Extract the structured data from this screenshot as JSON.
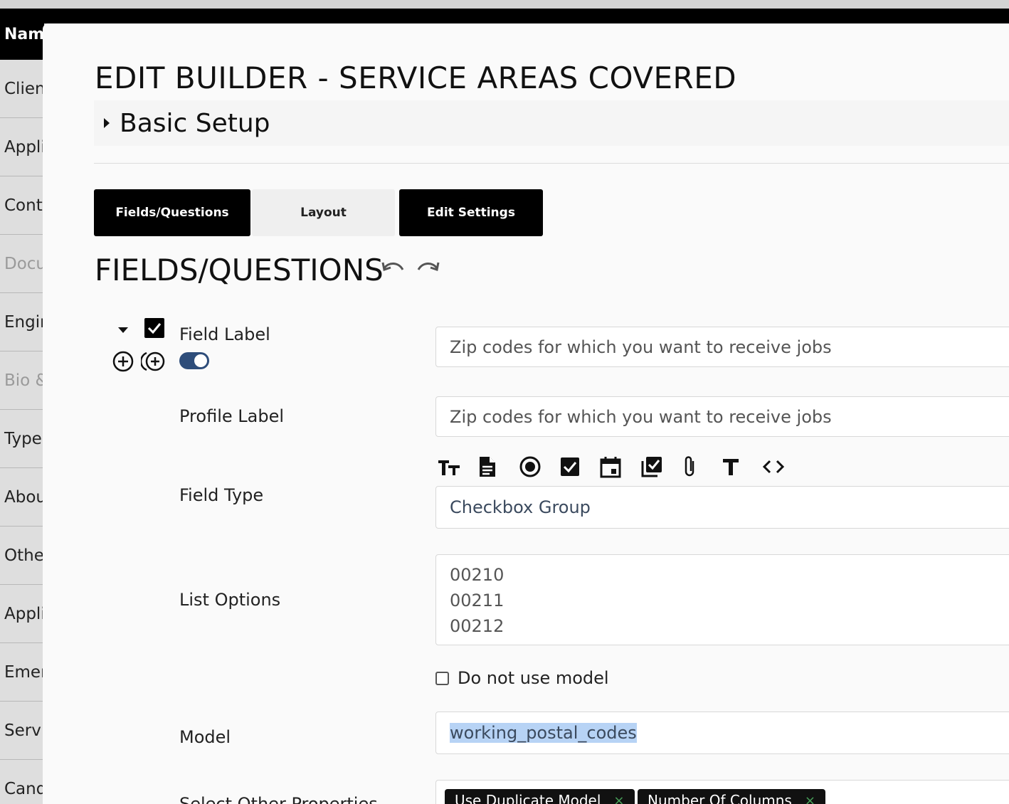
{
  "sidebar": {
    "header": "Nam",
    "items": [
      {
        "label": "Clien",
        "dim": false
      },
      {
        "label": "Appli",
        "dim": false
      },
      {
        "label": "Conta",
        "dim": false
      },
      {
        "label": "Docu",
        "dim": true
      },
      {
        "label": "Engir",
        "dim": false
      },
      {
        "label": "Bio &",
        "dim": true
      },
      {
        "label": "Type",
        "dim": false
      },
      {
        "label": "Abou",
        "dim": false
      },
      {
        "label": "Othe",
        "dim": false
      },
      {
        "label": "Appli",
        "dim": false
      },
      {
        "label": "Emer",
        "dim": false
      },
      {
        "label": "Servi",
        "dim": false
      },
      {
        "label": "Cand",
        "dim": false
      }
    ]
  },
  "modal": {
    "title": "EDIT BUILDER - SERVICE AREAS COVERED",
    "basic_setup": "Basic Setup",
    "tabs": {
      "fields": "Fields/Questions",
      "layout": "Layout",
      "settings": "Edit Settings"
    },
    "section_title": "FIELDS/QUESTIONS"
  },
  "field": {
    "field_label": {
      "label": "Field Label",
      "value": "Zip codes for which you want to receive jobs"
    },
    "profile_label": {
      "label": "Profile Label",
      "value": "Zip codes for which you want to receive jobs"
    },
    "field_type": {
      "label": "Field Type",
      "value": "Checkbox Group",
      "type_icons": [
        "text-size-icon",
        "document-icon",
        "radio-icon",
        "checkbox-icon",
        "calendar-icon",
        "checkbox-multiple-icon",
        "paperclip-icon",
        "text-icon",
        "code-icon"
      ]
    },
    "list_options": {
      "label": "List Options",
      "values": [
        "00210",
        "00211",
        "00212"
      ]
    },
    "no_model": {
      "label": "Do not use model",
      "checked": false
    },
    "model": {
      "label": "Model",
      "value": "working_postal_codes"
    },
    "other_props": {
      "label": "Select Other Properties",
      "chips": [
        "Use Duplicate Model",
        "Number Of Columns"
      ],
      "chip_remove": "×"
    }
  },
  "colors": {
    "toggle": "#2e4d7a",
    "selection": "#b7d3f5",
    "chip_x": "#49a35b"
  }
}
